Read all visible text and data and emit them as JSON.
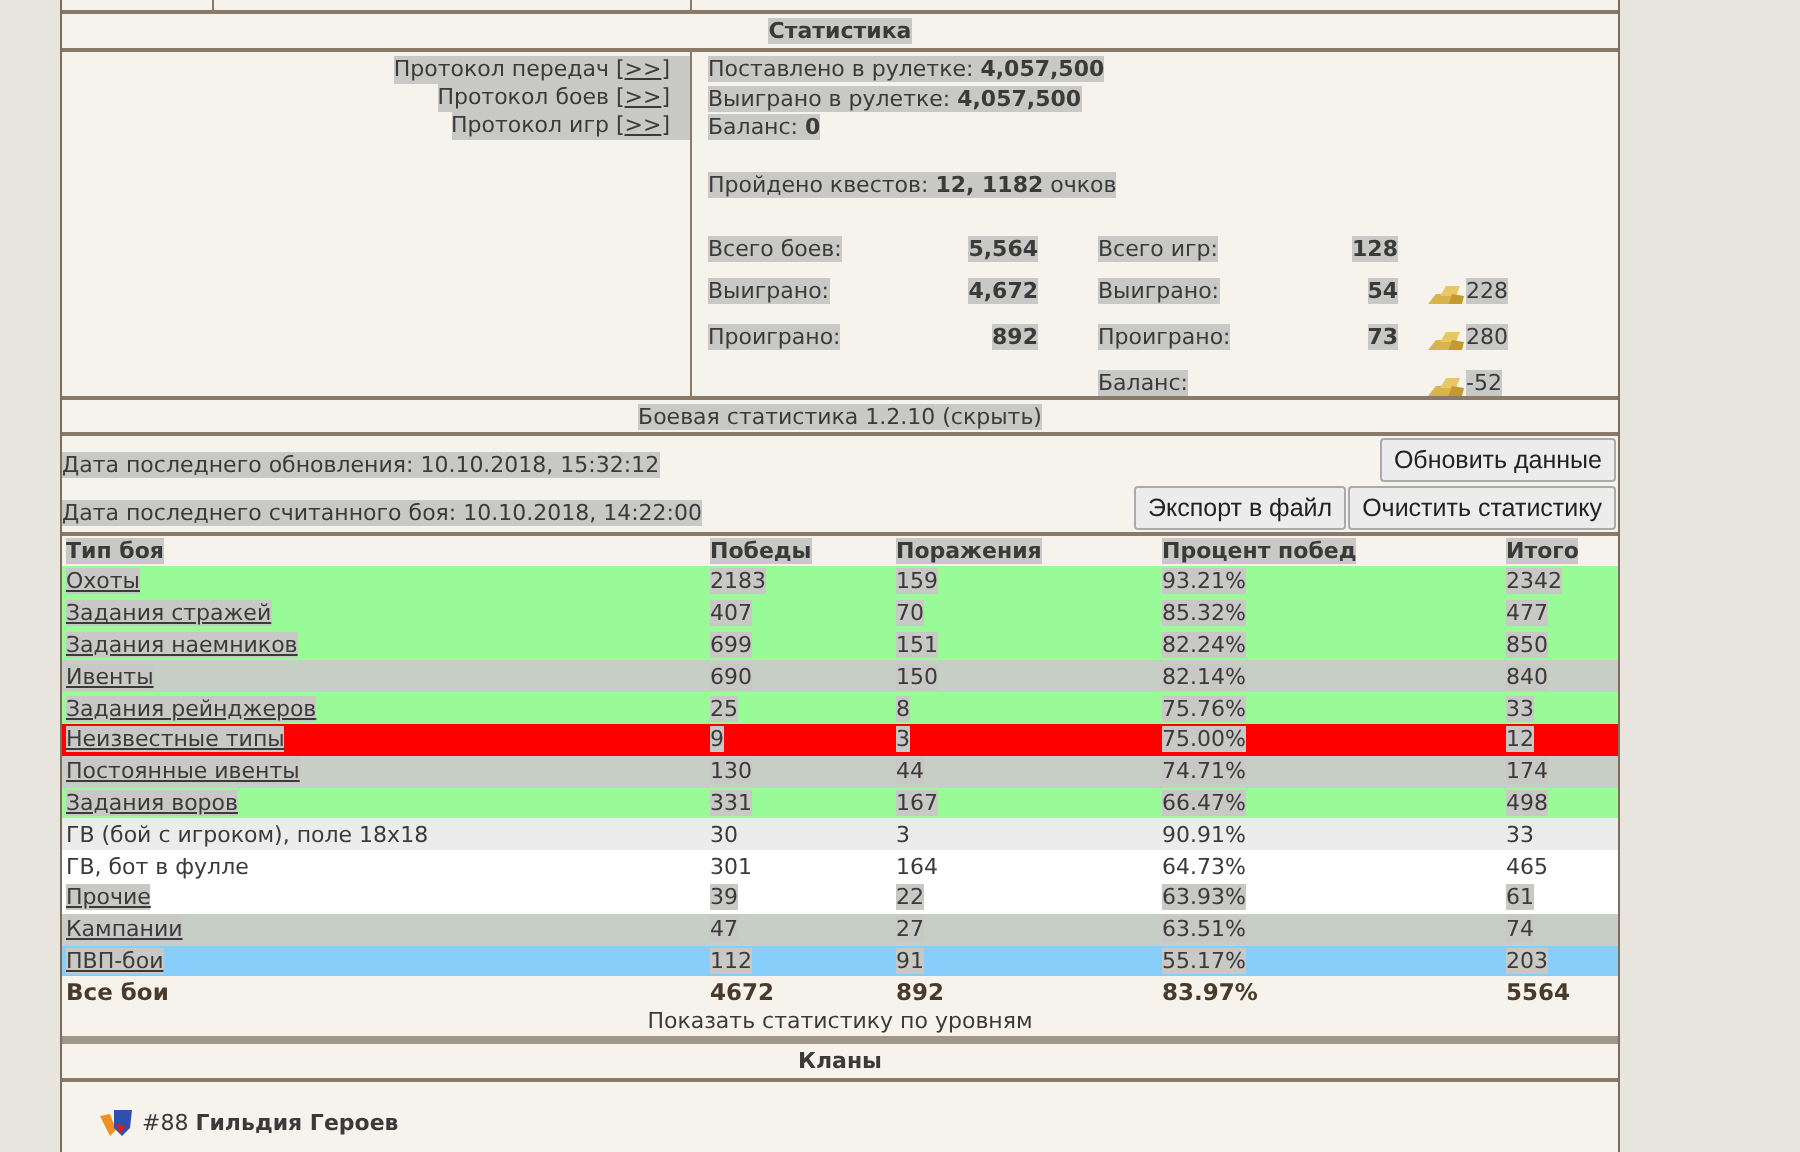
{
  "statistics": {
    "title": "Статистика",
    "protocols": [
      {
        "label": "Протокол передач",
        "open": "[",
        "link": ">>",
        "close": "]"
      },
      {
        "label": "Протокол боев",
        "open": "[",
        "link": ">>",
        "close": "]"
      },
      {
        "label": "Протокол игр",
        "open": "[",
        "link": ">>",
        "close": "]"
      }
    ],
    "roulette": [
      {
        "label": "Поставлено в рулетке:",
        "value": "4,057,500"
      },
      {
        "label": "Выиграно в рулетке:",
        "value": "4,057,500"
      },
      {
        "label": "Баланс:",
        "value": "0"
      }
    ],
    "quests": {
      "label": "Пройдено квестов:",
      "value": "12, 1182",
      "suffix": "очков"
    },
    "battles": [
      {
        "label": "Всего боев:",
        "value": "5,564"
      },
      {
        "label": "Выиграно:",
        "value": "4,672"
      },
      {
        "label": "Проиграно:",
        "value": "892"
      }
    ],
    "games": [
      {
        "label": "Всего игр:",
        "value": "128"
      },
      {
        "label": "Выиграно:",
        "value": "54",
        "gold": "228"
      },
      {
        "label": "Проиграно:",
        "value": "73",
        "gold": "280"
      },
      {
        "label": "Баланс:",
        "gold": "-52"
      }
    ]
  },
  "battle_stats": {
    "title": "Боевая статистика 1.2.10 (скрыть)",
    "last_update": "Дата последнего обновления: 10.10.2018, 15:32:12",
    "last_battle": "Дата последнего считанного боя: 10.10.2018, 14:22:00",
    "refresh_button": "Обновить данные",
    "export_button": "Экспорт в файл",
    "clear_button": "Очистить статистику",
    "table": {
      "columns": [
        "Тип боя",
        "Победы",
        "Поражения",
        "Процент побед",
        "Итого"
      ],
      "rows": [
        {
          "link": true,
          "color": "#98fb98",
          "cells": [
            "Охоты",
            "2183",
            "159",
            "93.21%",
            "2342"
          ]
        },
        {
          "link": true,
          "color": "#98fb98",
          "cells": [
            "Задания стражей",
            "407",
            "70",
            "85.32%",
            "477"
          ]
        },
        {
          "link": true,
          "color": "#98fb98",
          "cells": [
            "Задания наемников",
            "699",
            "151",
            "82.24%",
            "850"
          ]
        },
        {
          "link": true,
          "color": "#c6cec6",
          "cells": [
            "Ивенты",
            "690",
            "150",
            "82.14%",
            "840"
          ]
        },
        {
          "link": true,
          "color": "#98fb98",
          "cells": [
            "Задания рейнджеров",
            "25",
            "8",
            "75.76%",
            "33"
          ]
        },
        {
          "link": true,
          "color": "#ff0000",
          "cells": [
            "Неизвестные типы",
            "9",
            "3",
            "75.00%",
            "12"
          ]
        },
        {
          "link": true,
          "color": "#c6cec6",
          "cells": [
            "Постоянные ивенты",
            "130",
            "44",
            "74.71%",
            "174"
          ]
        },
        {
          "link": true,
          "color": "#98fb98",
          "cells": [
            "Задания воров",
            "331",
            "167",
            "66.47%",
            "498"
          ]
        },
        {
          "link": false,
          "color": "#ececec",
          "cells": [
            "ГВ (бой с игроком), поле 18x18",
            "30",
            "3",
            "90.91%",
            "33"
          ]
        },
        {
          "link": false,
          "color": "#ffffff",
          "cells": [
            "ГВ, бот в фулле",
            "301",
            "164",
            "64.73%",
            "465"
          ]
        },
        {
          "link": true,
          "color": "#ffffff",
          "cells": [
            "Прочие",
            "39",
            "22",
            "63.93%",
            "61"
          ]
        },
        {
          "link": true,
          "color": "#c6cec6",
          "cells": [
            "Кампании",
            "47",
            "27",
            "63.51%",
            "74"
          ]
        },
        {
          "link": true,
          "color": "#87cefa",
          "cells": [
            "ПВП-бои",
            "112",
            "91",
            "55.17%",
            "203"
          ]
        }
      ],
      "total": {
        "cells": [
          "Все бои",
          "4672",
          "892",
          "83.97%",
          "5564"
        ]
      }
    },
    "levels_link": "Показать статистику по уровням"
  },
  "clans": {
    "title": "Кланы",
    "items": [
      {
        "text": "#88 **Гильдия Героев**"
      }
    ]
  }
}
